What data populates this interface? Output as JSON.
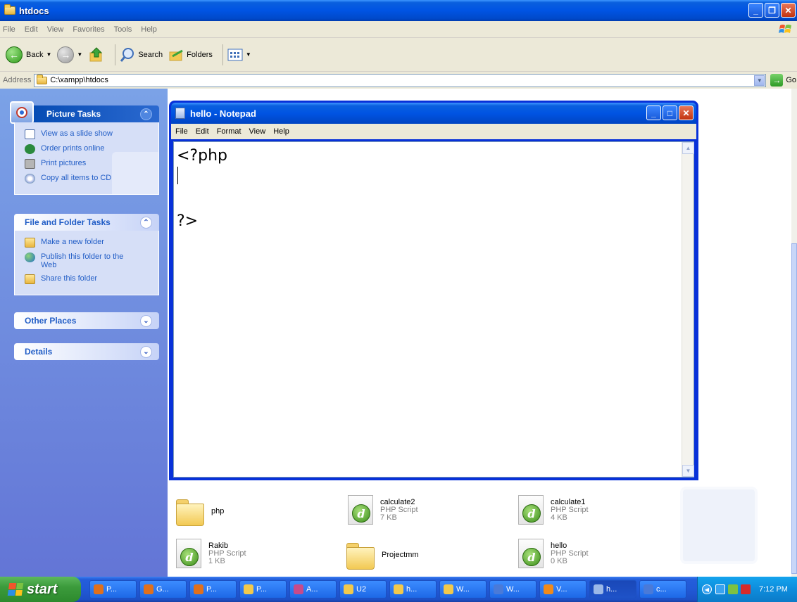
{
  "explorer": {
    "title": "htdocs",
    "menu": [
      "File",
      "Edit",
      "View",
      "Favorites",
      "Tools",
      "Help"
    ],
    "toolbar": {
      "back": "Back",
      "search": "Search",
      "folders": "Folders"
    },
    "address": {
      "label": "Address",
      "value": "C:\\xampp\\htdocs",
      "go": "Go"
    }
  },
  "taskpane": {
    "picture_tasks": {
      "title": "Picture Tasks",
      "items": [
        "View as a slide show",
        "Order prints online",
        "Print pictures",
        "Copy all items to CD"
      ]
    },
    "file_folder_tasks": {
      "title": "File and Folder Tasks",
      "items": [
        "Make a new folder",
        "Publish this folder to the Web",
        "Share this folder"
      ]
    },
    "other_places": {
      "title": "Other Places"
    },
    "details": {
      "title": "Details"
    }
  },
  "files": [
    {
      "name": "php",
      "type": "",
      "size": "",
      "kind": "folder"
    },
    {
      "name": "calculate2",
      "type": "PHP Script",
      "size": "7 KB",
      "kind": "php"
    },
    {
      "name": "calculate1",
      "type": "PHP Script",
      "size": "4 KB",
      "kind": "php"
    },
    {
      "name": "Rakib",
      "type": "PHP Script",
      "size": "1 KB",
      "kind": "php"
    },
    {
      "name": "Projectmm",
      "type": "",
      "size": "",
      "kind": "folder"
    },
    {
      "name": "hello",
      "type": "PHP Script",
      "size": "0 KB",
      "kind": "php"
    }
  ],
  "notepad": {
    "title": "hello - Notepad",
    "menu": [
      "File",
      "Edit",
      "Format",
      "View",
      "Help"
    ],
    "content": "<?php\n\n\n?>"
  },
  "taskbar": {
    "start": "start",
    "tasks": [
      {
        "label": "P...",
        "color": "#e0701c"
      },
      {
        "label": "G...",
        "color": "#e0701c"
      },
      {
        "label": "P...",
        "color": "#e0701c"
      },
      {
        "label": "P...",
        "color": "#f2c94c"
      },
      {
        "label": "A...",
        "color": "#c84a8a"
      },
      {
        "label": "U2",
        "color": "#f2c94c"
      },
      {
        "label": "h...",
        "color": "#f2c94c"
      },
      {
        "label": "W...",
        "color": "#f2c94c"
      },
      {
        "label": "W...",
        "color": "#4a7ad8"
      },
      {
        "label": "V...",
        "color": "#f08a1a"
      },
      {
        "label": "h...",
        "color": "#9bb8e8"
      },
      {
        "label": "c...",
        "color": "#4a7ad8"
      }
    ],
    "clock": "7:12 PM"
  }
}
